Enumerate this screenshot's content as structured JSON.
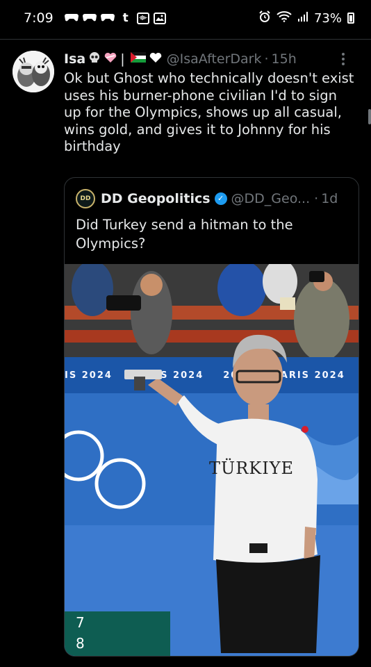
{
  "status_bar": {
    "time": "7:09",
    "notification_icons": [
      "t"
    ],
    "battery_percent": "73%"
  },
  "tweet": {
    "author_name": "Isa",
    "handle": "@IsaAfterDark",
    "separator": "·",
    "time": "15h",
    "text": "Ok but Ghost who technically doesn't exist uses his burner-phone civilian I'd to sign up for the Olympics, shows up all casual, wins gold, and gives it to Johnny for his birthday",
    "name_emoji": [
      "skull-emoji",
      "heart-emoji",
      "palestine-flag-emoji",
      "white-heart-emoji"
    ],
    "name_bar": "|"
  },
  "quoted_tweet": {
    "avatar_text": "DD",
    "author_name": "DD Geopolitics",
    "handle": "@DD_Geo...",
    "separator": "·",
    "time": "1d",
    "text": "Did Turkey send a hitman to the Olympics?",
    "media": {
      "banner_text": [
        "IS 2024",
        "PARIS 2024",
        "2024",
        "PARIS 2024"
      ],
      "jersey_text": "TÜRKIYE",
      "scoreboard": [
        "7",
        "8"
      ]
    }
  },
  "colors": {
    "background": "#000000",
    "text": "#e7e9ea",
    "secondary": "#71767b",
    "border": "#2f3336",
    "verified": "#1d9bf0"
  }
}
